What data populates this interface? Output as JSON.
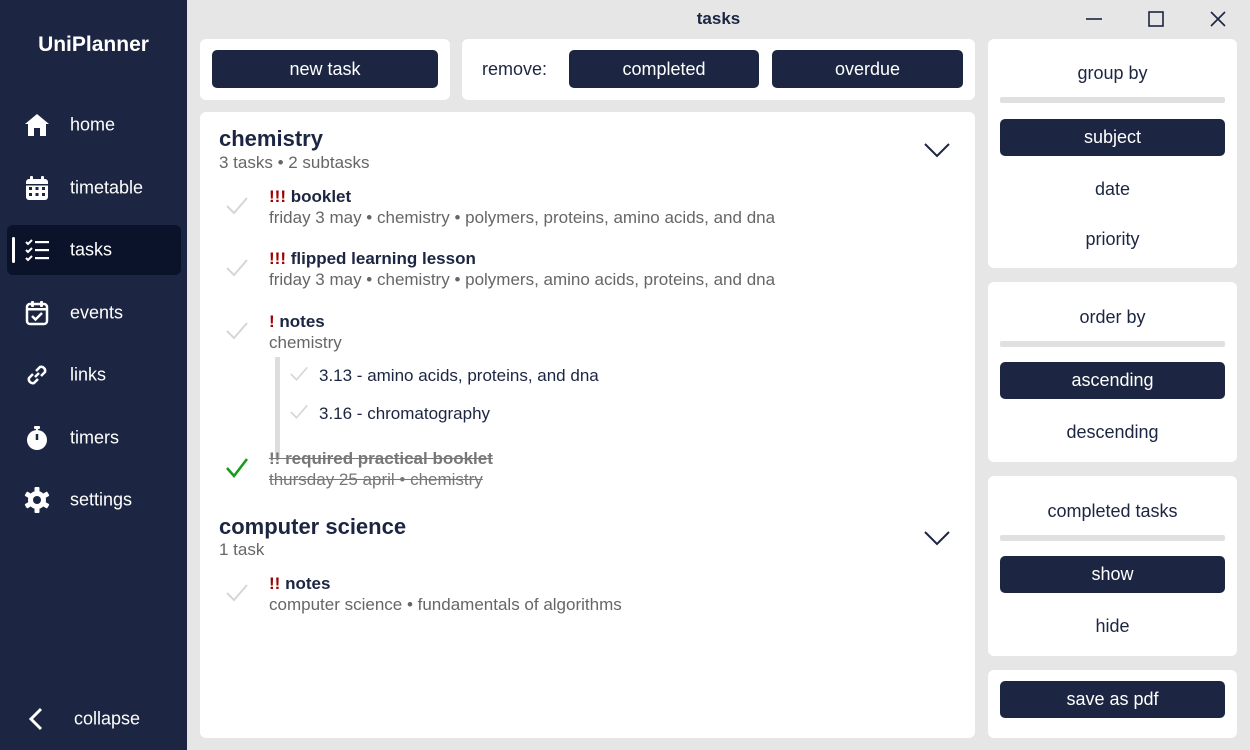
{
  "app": {
    "name": "UniPlanner"
  },
  "window": {
    "title": "tasks"
  },
  "sidebar": {
    "items": [
      {
        "label": "home",
        "icon": "home-icon"
      },
      {
        "label": "timetable",
        "icon": "calendar-grid-icon"
      },
      {
        "label": "tasks",
        "icon": "checklist-icon",
        "active": true
      },
      {
        "label": "events",
        "icon": "calendar-check-icon"
      },
      {
        "label": "links",
        "icon": "link-icon"
      },
      {
        "label": "timers",
        "icon": "stopwatch-icon"
      },
      {
        "label": "settings",
        "icon": "gear-icon"
      }
    ],
    "collapse_label": "collapse"
  },
  "toolbar": {
    "new_task_label": "new task",
    "remove_label": "remove:",
    "completed_label": "completed",
    "overdue_label": "overdue"
  },
  "groups": [
    {
      "name": "chemistry",
      "summary": "3 tasks • 2 subtasks",
      "tasks": [
        {
          "priority": "!!!",
          "title": "booklet",
          "meta": "friday 3 may • chemistry • polymers, proteins, amino acids, and dna",
          "completed": false
        },
        {
          "priority": "!!!",
          "title": "flipped learning lesson",
          "meta": "friday 3 may • chemistry • polymers, amino acids, proteins, and dna",
          "completed": false
        },
        {
          "priority": "!",
          "title": "notes",
          "meta": "chemistry",
          "completed": false,
          "subtasks": [
            "3.13 - amino acids, proteins, and dna",
            "3.16 - chromatography"
          ]
        },
        {
          "priority": "!!",
          "title": "required practical booklet",
          "meta": "thursday 25 april • chemistry",
          "completed": true
        }
      ]
    },
    {
      "name": "computer science",
      "summary": "1 task",
      "tasks": [
        {
          "priority": "!!",
          "title": "notes",
          "meta": "computer science • fundamentals of algorithms",
          "completed": false
        }
      ]
    }
  ],
  "group_by": {
    "heading": "group by",
    "options": [
      "subject",
      "date",
      "priority"
    ],
    "selected": "subject"
  },
  "order_by": {
    "heading": "order by",
    "options": [
      "ascending",
      "descending"
    ],
    "selected": "ascending"
  },
  "completed_tasks": {
    "heading": "completed tasks",
    "options": [
      "show",
      "hide"
    ],
    "selected": "show"
  },
  "export": {
    "save_pdf_label": "save as pdf"
  },
  "colors": {
    "navy": "#1c2541",
    "active": "#0b132b",
    "priority": "#a00000",
    "done_check": "#1a9c1a"
  }
}
